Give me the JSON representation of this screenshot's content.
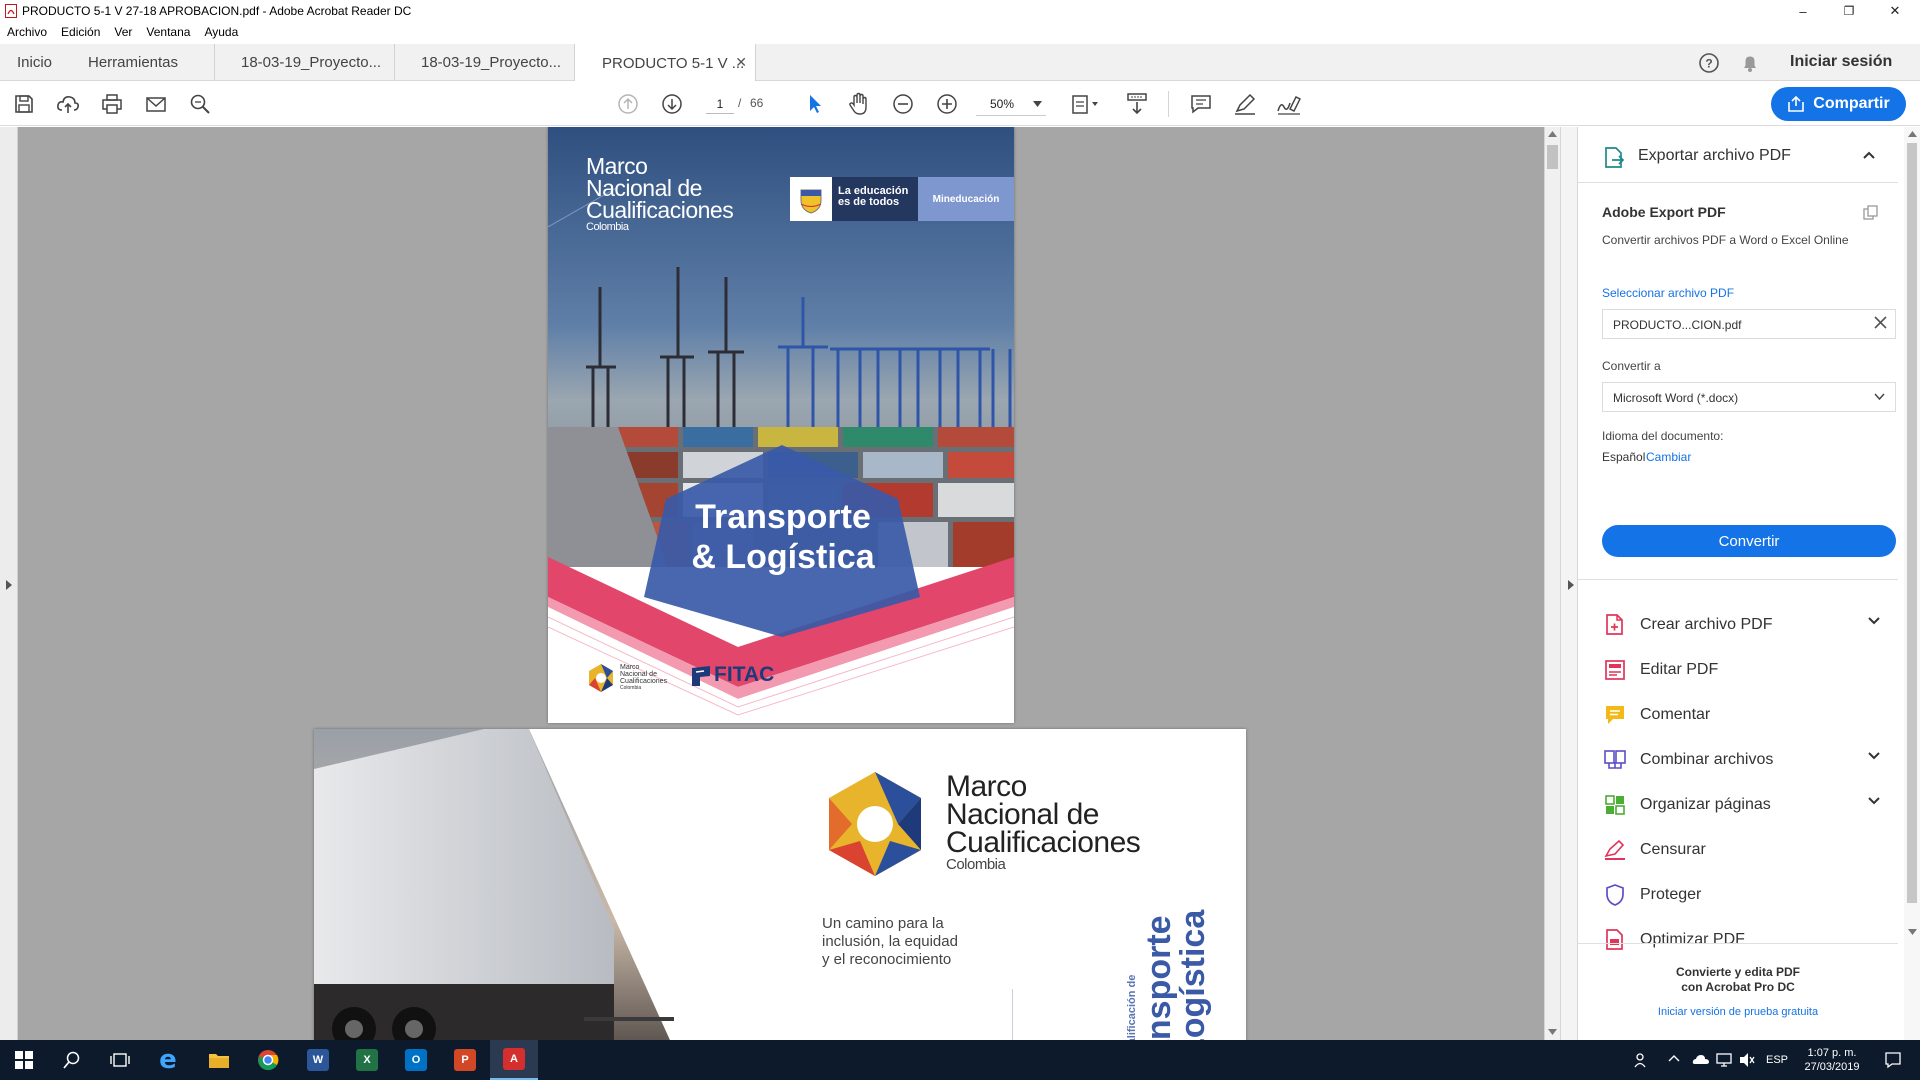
{
  "window": {
    "title": "PRODUCTO 5-1 V 27-18 APROBACION.pdf - Adobe Acrobat Reader DC",
    "minimize": "–",
    "maximize": "❐",
    "close": "✕"
  },
  "menu": [
    "Archivo",
    "Edición",
    "Ver",
    "Ventana",
    "Ayuda"
  ],
  "tabs": {
    "home": "Inicio",
    "tools": "Herramientas",
    "docs": [
      {
        "label": "18-03-19_Proyecto..."
      },
      {
        "label": "18-03-19_Proyecto..."
      },
      {
        "label": "PRODUCTO 5-1 V ..."
      }
    ],
    "signin": "Iniciar sesión"
  },
  "toolbar": {
    "page_current": "1",
    "page_sep": "/",
    "page_total": "66",
    "zoom": "50%",
    "share": "Compartir"
  },
  "document": {
    "page1": {
      "brand_line1": "Marco",
      "brand_line2": "Nacional de",
      "brand_line3": "Cualificaciones",
      "brand_country": "Colombia",
      "badge_line1": "La educación",
      "badge_line2": "es de todos",
      "badge_ministry": "Mineducación",
      "headline1": "Transporte",
      "headline2": "& Logística",
      "footer_logo_line1": "Marco",
      "footer_logo_line2": "Nacional de",
      "footer_logo_line3": "Cualificaciones",
      "footer_logo_line4": "Colombia",
      "fitac": "FITAC"
    },
    "page2": {
      "brand_line1": "Marco",
      "brand_line2": "Nacional de",
      "brand_line3": "Cualificaciones",
      "brand_country": "Colombia",
      "tagline1": "Un camino para la",
      "tagline2": "inclusión, la equidad",
      "tagline3": "y el reconocimiento",
      "vertical_small": "Cualificación de",
      "vertical_big1": "ansporte",
      "vertical_big2": "Logística"
    }
  },
  "panel": {
    "export_header": "Exportar archivo PDF",
    "adobe_export_title": "Adobe Export PDF",
    "adobe_export_desc": "Convertir archivos PDF a Word o Excel Online",
    "select_file_label": "Seleccionar archivo PDF",
    "selected_file": "PRODUCTO...CION.pdf",
    "convert_to_label": "Convertir a",
    "convert_to_value": "Microsoft Word (*.docx)",
    "language_label": "Idioma del documento:",
    "language_value": "Español",
    "language_change": "Cambiar",
    "convert_button": "Convertir",
    "tools": [
      {
        "label": "Crear archivo PDF",
        "icon": "create-pdf-icon",
        "chevron": true
      },
      {
        "label": "Editar PDF",
        "icon": "edit-pdf-icon",
        "chevron": false
      },
      {
        "label": "Comentar",
        "icon": "comment-icon",
        "chevron": false
      },
      {
        "label": "Combinar archivos",
        "icon": "combine-icon",
        "chevron": true
      },
      {
        "label": "Organizar páginas",
        "icon": "organize-icon",
        "chevron": true
      },
      {
        "label": "Censurar",
        "icon": "redact-icon",
        "chevron": false
      },
      {
        "label": "Proteger",
        "icon": "protect-icon",
        "chevron": false
      },
      {
        "label": "Optimizar PDF",
        "icon": "optimize-icon",
        "chevron": false
      }
    ],
    "promo_line1": "Convierte y edita PDF",
    "promo_line2": "con Acrobat Pro DC",
    "promo_link": "Iniciar versión de prueba gratuita"
  },
  "taskbar": {
    "lang": "ESP",
    "time": "1:07 p. m.",
    "date": "27/03/2019"
  },
  "colors": {
    "accent": "#1473e6",
    "taskbar": "#0d1a2b",
    "cover_pink": "#e2466b",
    "cover_blue": "#3a5aa8"
  }
}
